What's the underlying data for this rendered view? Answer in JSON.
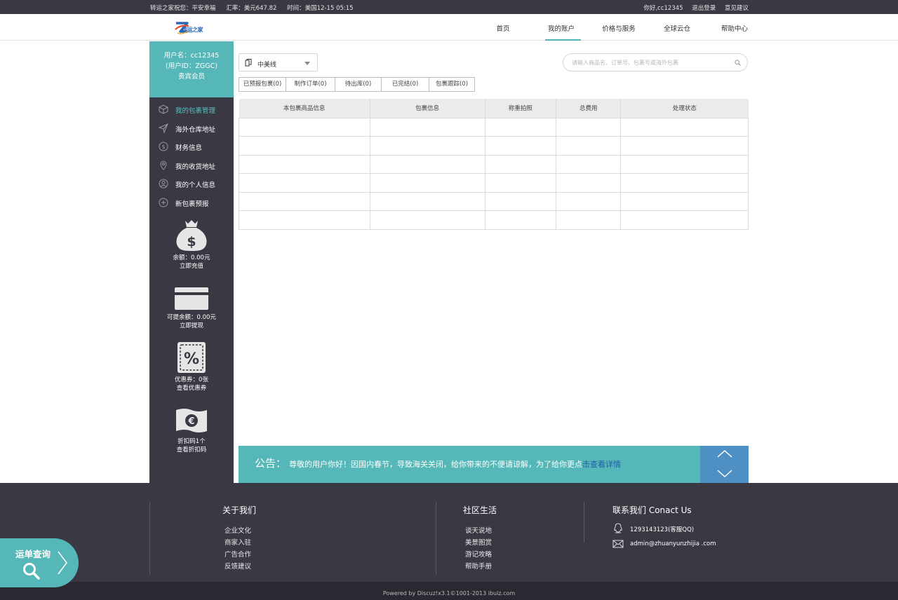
{
  "topbar": {
    "greeting": "转运之家祝您：平安幸福",
    "rate": "汇率：美元647.82",
    "time": "时间：美国12-15 05:15",
    "hello_user": "你好,cc12345",
    "logout": "退出登录",
    "feedback": "意见建议"
  },
  "header": {
    "logo_text": "转运之家",
    "nav": [
      {
        "label": "首页",
        "active": false
      },
      {
        "label": "我的账户",
        "active": true
      },
      {
        "label": "价格与服务",
        "active": false
      },
      {
        "label": "全球云仓",
        "active": false
      },
      {
        "label": "帮助中心",
        "active": false
      }
    ]
  },
  "sidebar": {
    "username": "用户名：cc12345",
    "user_id": "(用户ID：ZGGC)",
    "level": "贵宾会员",
    "menu": [
      {
        "label": "我的包裹管理",
        "icon": "package-icon",
        "active": true
      },
      {
        "label": "海外仓库地址",
        "icon": "send-icon",
        "active": false
      },
      {
        "label": "财务信息",
        "icon": "finance-icon",
        "active": false
      },
      {
        "label": "我的收货地址",
        "icon": "location-icon",
        "active": false
      },
      {
        "label": "我的个人信息",
        "icon": "user-icon",
        "active": false
      },
      {
        "label": "新包裹预报",
        "icon": "add-icon",
        "active": false
      }
    ],
    "balance": {
      "amount": "余额：0.00元",
      "action": "立即充值"
    },
    "withdraw": {
      "amount": "可提余额：0.00元",
      "action": "立即提现"
    },
    "coupon": {
      "amount": "优惠券：0张",
      "action": "查看优惠券"
    },
    "discount": {
      "amount": "折扣码1个",
      "action": "查看折扣码"
    }
  },
  "main": {
    "line_select": "中美线",
    "search_placeholder": "请输入商品名、订单号、包裹号或海外包裹",
    "tabs": [
      "已预报包裹(0)",
      "制作订单(0)",
      "待出库(0)",
      "已完结(0)",
      "包裹跟踪(0)"
    ],
    "table_headers": [
      "本包裹商品信息",
      "包裹信息",
      "称重拍照",
      "总费用",
      "处理状态"
    ],
    "table_rows": 6
  },
  "notice": {
    "title": "公告：",
    "text": "尊敬的用户你好！因国内春节，导致海关关闭，给你带来的不便请谅解，为了给你更点",
    "link": "击查看详情"
  },
  "footer": {
    "about": {
      "title": "关于我们",
      "links": [
        "企业文化",
        "商家入驻",
        "广告合作",
        "反馈建议"
      ]
    },
    "community": {
      "title": "社区生活",
      "links": [
        "谈天说地",
        "美景图赏",
        "游记攻略",
        "帮助手册"
      ]
    },
    "contact": {
      "title": "联系我们 Conact Us",
      "qq": "1293143123(客服QQ)",
      "email": "admin@zhuanyunzhijia .com"
    },
    "copyright": "Powered by Discuz!x3.1©1001-2013  ibuiz.com"
  },
  "track_button": {
    "label": "运单查询"
  },
  "colors": {
    "teal": "#55b7b7",
    "dark": "#3a3842",
    "blue": "#4e8fc4",
    "link": "#1f5fa7"
  }
}
